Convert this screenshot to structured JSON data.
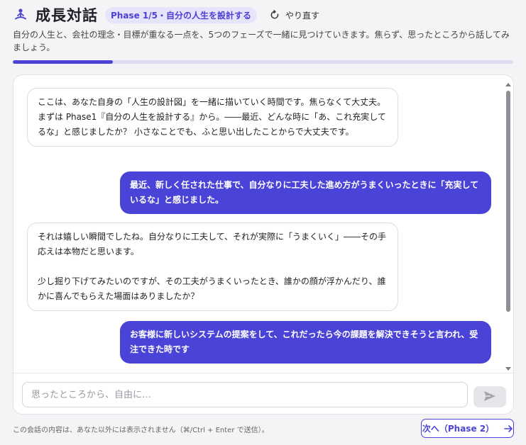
{
  "header": {
    "title": "成長対話",
    "phase_badge": "Phase 1/5・自分の人生を設計する",
    "redo_label": "やり直す",
    "logo_icon": "meditation-icon",
    "accent_color": "#4b44d6"
  },
  "description": "自分の人生と、会社の理念・目標が重なる一点を、5つのフェーズで一緒に見つけていきます。焦らず、思ったところから話してみましょう。",
  "progress": {
    "phase": 1,
    "total": 5,
    "fraction": 0.2
  },
  "messages": [
    {
      "role": "ai",
      "text": "ここは、あなた自身の「人生の設計図」を一緒に描いていく時間です。焦らなくて大丈夫。まずは Phase1『自分の人生を設計する』から。――最近、どんな時に「あ、これ充実してるな」と感じましたか？ 小さなことでも、ふと思い出したことからで大丈夫です。"
    },
    {
      "role": "user",
      "text": "最近、新しく任された仕事で、自分なりに工夫した進め方がうまくいったときに「充実しているな」と感じました。"
    },
    {
      "role": "ai",
      "text": "それは嬉しい瞬間でしたね。自分なりに工夫して、それが実際に「うまくいく」――その手応えは本物だと思います。\n\n少し掘り下げてみたいのですが、その工夫がうまくいったとき、誰かの顔が浮かんだり、誰かに喜んでもらえた場面はありましたか？"
    },
    {
      "role": "user",
      "text": "お客様に新しいシステムの提案をして、これだったら今の課題を解決できそうと言われ、受注できた時です"
    }
  ],
  "input": {
    "placeholder": "思ったところから、自由に…",
    "value": ""
  },
  "send_icon": "paper-plane-icon",
  "footer": {
    "note": "この会話の内容は、あなた以外には表示されません（⌘/Ctrl + Enter で送信）。",
    "next_label": "次へ（Phase 2）"
  }
}
